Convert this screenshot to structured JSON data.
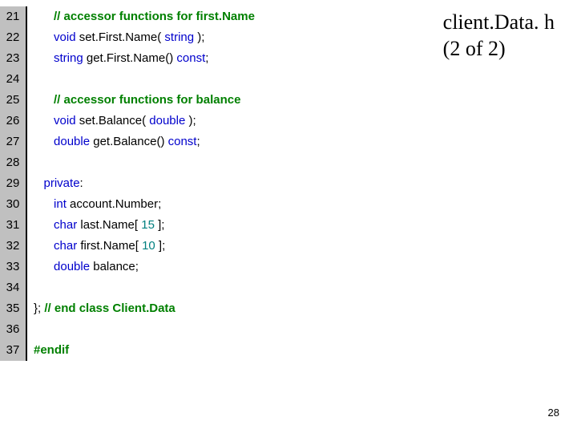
{
  "title": {
    "line1": "client.Data. h",
    "line2": "(2 of 2)"
  },
  "page_number": "28",
  "lines": [
    {
      "n": "21",
      "indent": 6,
      "tokens": [
        {
          "t": "// accessor functions for first.Name",
          "c": "cm"
        }
      ]
    },
    {
      "n": "22",
      "indent": 6,
      "tokens": [
        {
          "t": "void",
          "c": "kw"
        },
        {
          "t": " set.First.Name( ",
          "c": "txt"
        },
        {
          "t": "string",
          "c": "kw"
        },
        {
          "t": " );",
          "c": "txt"
        }
      ]
    },
    {
      "n": "23",
      "indent": 6,
      "tokens": [
        {
          "t": "string",
          "c": "kw"
        },
        {
          "t": " get.First.Name() ",
          "c": "txt"
        },
        {
          "t": "const",
          "c": "kw"
        },
        {
          "t": ";",
          "c": "txt"
        }
      ]
    },
    {
      "n": "24",
      "indent": 0,
      "tokens": []
    },
    {
      "n": "25",
      "indent": 6,
      "tokens": [
        {
          "t": "// accessor functions for balance",
          "c": "cm"
        }
      ]
    },
    {
      "n": "26",
      "indent": 6,
      "tokens": [
        {
          "t": "void",
          "c": "kw"
        },
        {
          "t": " set.Balance( ",
          "c": "txt"
        },
        {
          "t": "double",
          "c": "kw"
        },
        {
          "t": " );",
          "c": "txt"
        }
      ]
    },
    {
      "n": "27",
      "indent": 6,
      "tokens": [
        {
          "t": "double",
          "c": "kw"
        },
        {
          "t": " get.Balance() ",
          "c": "txt"
        },
        {
          "t": "const",
          "c": "kw"
        },
        {
          "t": ";",
          "c": "txt"
        }
      ]
    },
    {
      "n": "28",
      "indent": 0,
      "tokens": []
    },
    {
      "n": "29",
      "indent": 3,
      "tokens": [
        {
          "t": "private",
          "c": "kw"
        },
        {
          "t": ":",
          "c": "txt"
        }
      ]
    },
    {
      "n": "30",
      "indent": 6,
      "tokens": [
        {
          "t": "int",
          "c": "kw"
        },
        {
          "t": " account.Number;",
          "c": "txt"
        }
      ]
    },
    {
      "n": "31",
      "indent": 6,
      "tokens": [
        {
          "t": "char",
          "c": "kw"
        },
        {
          "t": " last.Name[ ",
          "c": "txt"
        },
        {
          "t": "15",
          "c": "lit"
        },
        {
          "t": " ];",
          "c": "txt"
        }
      ]
    },
    {
      "n": "32",
      "indent": 6,
      "tokens": [
        {
          "t": "char",
          "c": "kw"
        },
        {
          "t": " first.Name[ ",
          "c": "txt"
        },
        {
          "t": "10",
          "c": "lit"
        },
        {
          "t": " ];",
          "c": "txt"
        }
      ]
    },
    {
      "n": "33",
      "indent": 6,
      "tokens": [
        {
          "t": "double",
          "c": "kw"
        },
        {
          "t": " balance;",
          "c": "txt"
        }
      ]
    },
    {
      "n": "34",
      "indent": 0,
      "tokens": []
    },
    {
      "n": "35",
      "indent": 0,
      "tokens": [
        {
          "t": "}; ",
          "c": "txt"
        },
        {
          "t": "// end class Client.Data",
          "c": "cm"
        }
      ]
    },
    {
      "n": "36",
      "indent": 0,
      "tokens": []
    },
    {
      "n": "37",
      "indent": 0,
      "tokens": [
        {
          "t": "#endif",
          "c": "pp"
        }
      ]
    }
  ]
}
